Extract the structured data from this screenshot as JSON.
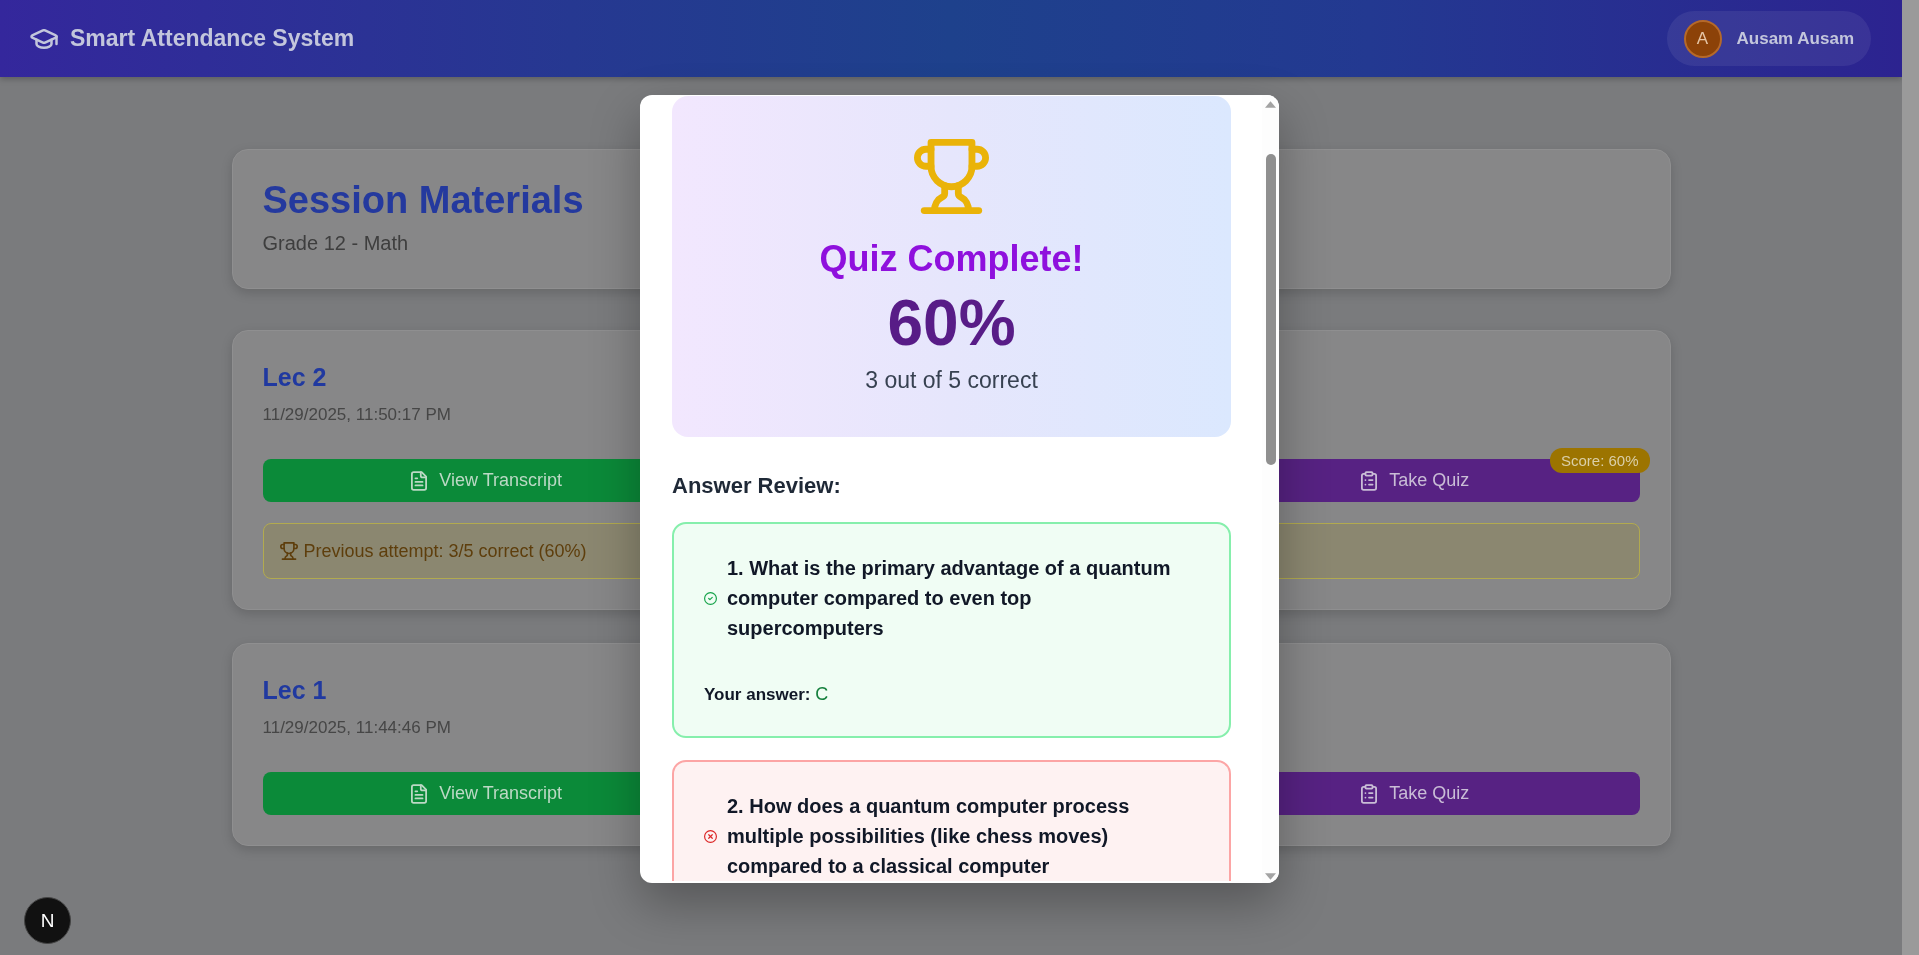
{
  "header": {
    "title": "Smart Attendance System",
    "user": {
      "initial": "A",
      "name": "Ausam Ausam"
    }
  },
  "page": {
    "title": "Session Materials",
    "subtitle": "Grade 12 - Math"
  },
  "sessions": [
    {
      "title": "Lec 2",
      "date": "11/29/2025, 11:50:17 PM",
      "transcript_button": "View Transcript",
      "quiz_button": "Take Quiz",
      "score_badge": "Score: 60%",
      "previous_attempt": "Previous attempt: 3/5 correct (60%)"
    },
    {
      "title": "Lec 1",
      "date": "11/29/2025, 11:44:46 PM",
      "transcript_button": "View Transcript",
      "quiz_button": "Take Quiz"
    }
  ],
  "quiz_result_modal": {
    "title": "Quiz Complete!",
    "score": "60%",
    "summary": "3 out of 5 correct",
    "review_heading": "Answer Review:",
    "answers": [
      {
        "question": "1. What is the primary advantage of a quantum computer compared to even top supercomputers",
        "correct": true,
        "answer_label": "Your answer:",
        "answer": "C"
      },
      {
        "question": "2. How does a quantum computer process multiple possibilities (like chess moves) compared to a classical computer",
        "correct": false
      }
    ]
  },
  "dev_indicator": {
    "label": "N"
  }
}
